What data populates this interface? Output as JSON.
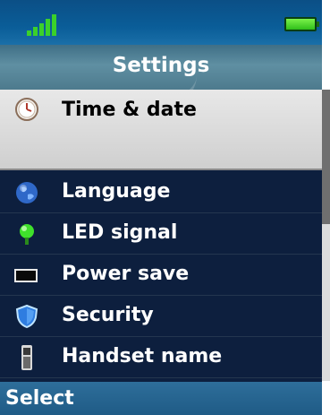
{
  "status": {
    "signal_icon": "signal-strength-icon",
    "battery_icon": "battery-full-icon",
    "signal_color": "#3bd12a",
    "battery_color": "#4fdc2a"
  },
  "header": {
    "title": "Settings"
  },
  "menu": {
    "items": [
      {
        "label": "Time & date",
        "icon": "clock-icon",
        "selected": true
      },
      {
        "label": "Language",
        "icon": "globe-icon"
      },
      {
        "label": "LED signal",
        "icon": "led-bulb-icon"
      },
      {
        "label": "Power save",
        "icon": "display-icon"
      },
      {
        "label": "Security",
        "icon": "shield-icon"
      },
      {
        "label": "Handset name",
        "icon": "handset-icon"
      }
    ]
  },
  "softkeys": {
    "left": "Select"
  },
  "colors": {
    "background": "#0d1f3e",
    "selection": "#d9d9d9",
    "softkey_bar": "#2a6a96",
    "title_bar": "#557f93"
  }
}
